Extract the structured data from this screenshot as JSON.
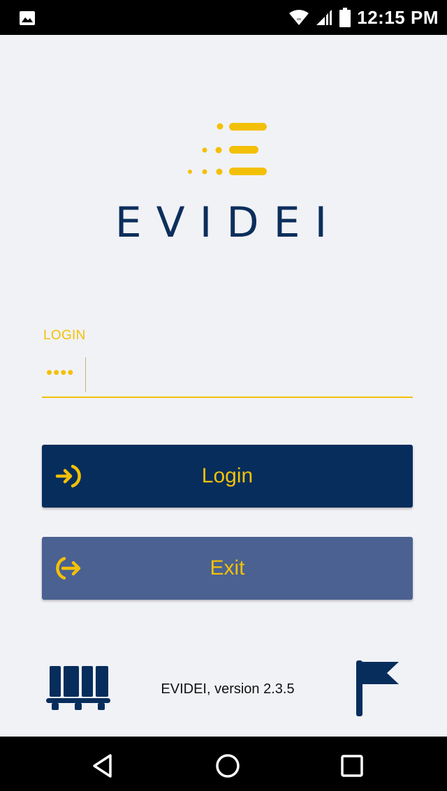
{
  "status_bar": {
    "time": "12:15 PM",
    "icons": [
      "image-icon",
      "wifi-icon",
      "signal-icon",
      "battery-icon"
    ]
  },
  "brand": {
    "name": "EVIDEI",
    "colors": {
      "navy": "#0c2e5c",
      "accent": "#f3c008"
    }
  },
  "login_field": {
    "label": "LOGIN",
    "value": "••••"
  },
  "buttons": {
    "login": {
      "label": "Login",
      "icon": "login-arrow-icon",
      "background": "#062d5c"
    },
    "exit": {
      "label": "Exit",
      "icon": "exit-arrow-icon",
      "background": "#4a6191"
    }
  },
  "footer": {
    "version": "EVIDEI, version 2.3.5",
    "left_icon": "pallet-icon",
    "right_icon": "flag-icon"
  },
  "nav_bar": {
    "icons": [
      "back-icon",
      "home-icon",
      "recent-apps-icon"
    ]
  }
}
